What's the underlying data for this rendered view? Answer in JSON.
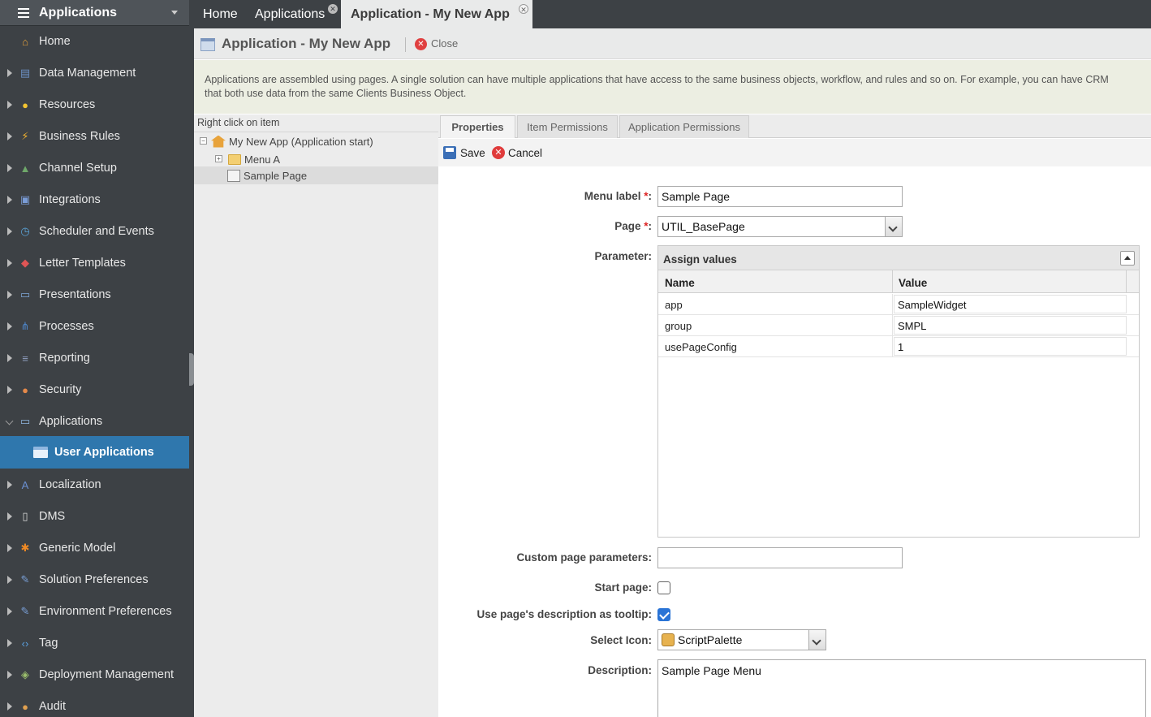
{
  "sidebar": {
    "title": "Applications",
    "items": [
      {
        "label": "Home",
        "icon": "home-icon",
        "color": "#e8a33b",
        "expand": false
      },
      {
        "label": "Data Management",
        "icon": "data-management-icon",
        "color": "#6b8fc2",
        "expand": true
      },
      {
        "label": "Resources",
        "icon": "lightbulb-icon",
        "color": "#f2c331",
        "expand": true
      },
      {
        "label": "Business Rules",
        "icon": "lightning-icon",
        "color": "#f2b22f",
        "expand": true
      },
      {
        "label": "Channel Setup",
        "icon": "channel-icon",
        "color": "#6fa86a",
        "expand": true
      },
      {
        "label": "Integrations",
        "icon": "integrations-icon",
        "color": "#7a9cd6",
        "expand": true
      },
      {
        "label": "Scheduler and Events",
        "icon": "clock-icon",
        "color": "#5aa3d8",
        "expand": true
      },
      {
        "label": "Letter Templates",
        "icon": "letter-icon",
        "color": "#e05555",
        "expand": true
      },
      {
        "label": "Presentations",
        "icon": "presentation-icon",
        "color": "#7fa7d8",
        "expand": true
      },
      {
        "label": "Processes",
        "icon": "process-icon",
        "color": "#4e86c9",
        "expand": true
      },
      {
        "label": "Reporting",
        "icon": "report-icon",
        "color": "#8f9fc0",
        "expand": true
      },
      {
        "label": "Security",
        "icon": "security-icon",
        "color": "#e5894a",
        "expand": true
      },
      {
        "label": "Applications",
        "icon": "applications-icon",
        "color": "#8fb6df",
        "expand": "open"
      },
      {
        "label": "Localization",
        "icon": "localization-icon",
        "color": "#6a8fd0",
        "expand": true
      },
      {
        "label": "DMS",
        "icon": "document-icon",
        "color": "#d8d8d8",
        "expand": true
      },
      {
        "label": "Generic Model",
        "icon": "asterisk-icon",
        "color": "#f08a24",
        "expand": true
      },
      {
        "label": "Solution Preferences",
        "icon": "solution-preferences-icon",
        "color": "#7aa0d8",
        "expand": true
      },
      {
        "label": "Environment Preferences",
        "icon": "environment-preferences-icon",
        "color": "#7aa0d8",
        "expand": true
      },
      {
        "label": "Tag",
        "icon": "code-tag-icon",
        "color": "#5aa0e0",
        "expand": true
      },
      {
        "label": "Deployment Management",
        "icon": "deployment-icon",
        "color": "#9bbf6c",
        "expand": true
      },
      {
        "label": "Audit",
        "icon": "audit-icon",
        "color": "#e0a050",
        "expand": true
      }
    ],
    "sub_item": "User Applications"
  },
  "tabs": [
    {
      "label": "Home"
    },
    {
      "label": "Applications"
    },
    {
      "label": "Application - My New App"
    }
  ],
  "titlebar": {
    "title": "Application - My New App",
    "close_label": "Close"
  },
  "info": {
    "line1": "Applications are assembled using pages. A single solution can have multiple applications that have access to the same business objects, workflow, and rules and so on. For example, you can have CRM",
    "line2": "that both use data from the same Clients Business Object."
  },
  "tree": {
    "hint": "Right click on item",
    "root": "My New App (Application start)",
    "menu": "Menu A",
    "page": "Sample Page"
  },
  "subtabs": [
    "Properties",
    "Item Permissions",
    "Application Permissions"
  ],
  "toolbar": {
    "save": "Save",
    "cancel": "Cancel"
  },
  "form": {
    "menu_label": {
      "label": "Menu label",
      "value": "Sample Page"
    },
    "page": {
      "label": "Page",
      "value": "UTIL_BasePage"
    },
    "parameter": {
      "label": "Parameter:",
      "header": "Assign values",
      "col_name": "Name",
      "col_value": "Value",
      "rows": [
        {
          "name": "app",
          "value": "SampleWidget"
        },
        {
          "name": "group",
          "value": "SMPL"
        },
        {
          "name": "usePageConfig",
          "value": "1"
        }
      ]
    },
    "custom_params": {
      "label": "Custom page parameters:",
      "value": ""
    },
    "start_page": {
      "label": "Start page:",
      "checked": false
    },
    "use_desc": {
      "label": "Use page's description as tooltip:",
      "checked": true
    },
    "select_icon": {
      "label": "Select Icon:",
      "value": "ScriptPalette"
    },
    "description": {
      "label": "Description:",
      "value": "Sample Page Menu"
    }
  }
}
